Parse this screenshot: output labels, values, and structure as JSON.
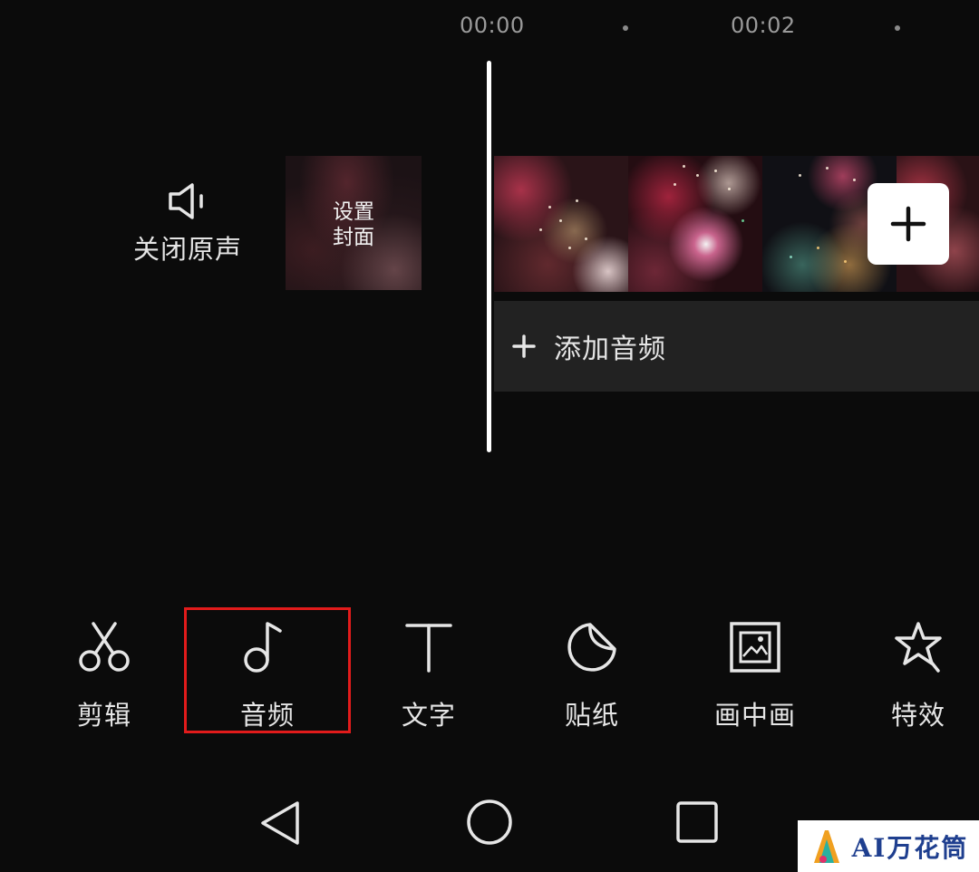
{
  "timeline": {
    "time_start": "00:00",
    "time_mid": "00:02"
  },
  "mute": {
    "icon": "speaker-icon",
    "label": "关闭原声"
  },
  "cover": {
    "label": "设置封面"
  },
  "add_clip": {
    "icon": "plus-icon"
  },
  "add_audio": {
    "icon": "plus-icon",
    "label": "添加音频"
  },
  "toolbar": {
    "items": [
      {
        "icon": "scissors-icon",
        "label": "剪辑"
      },
      {
        "icon": "music-note-icon",
        "label": "音频",
        "highlighted": true
      },
      {
        "icon": "text-icon",
        "label": "文字"
      },
      {
        "icon": "sticker-icon",
        "label": "贴纸"
      },
      {
        "icon": "picture-in-picture-icon",
        "label": "画中画"
      },
      {
        "icon": "star-effect-icon",
        "label": "特效"
      }
    ]
  },
  "nav": {
    "back": "back-triangle-icon",
    "home": "home-circle-icon",
    "recents": "recents-square-icon"
  },
  "watermark": {
    "text": "AI万花筒"
  },
  "colors": {
    "background": "#0b0b0b",
    "highlight": "#e21b1b",
    "panel": "#222222"
  }
}
